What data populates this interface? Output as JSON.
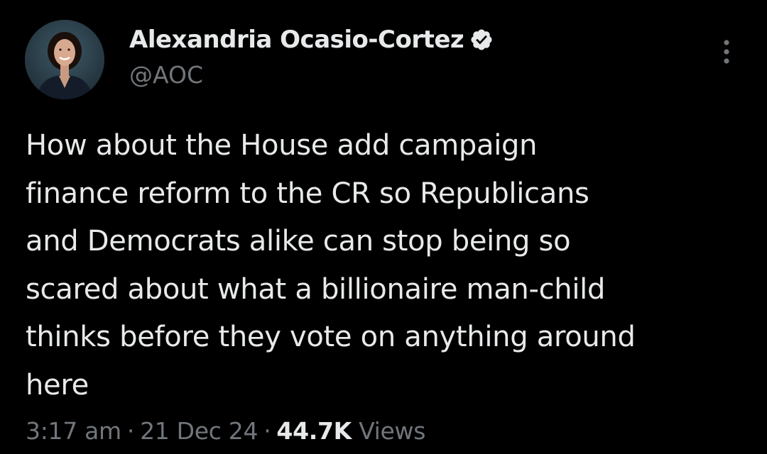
{
  "author": {
    "display_name": "Alexandria Ocasio-Cortez",
    "handle": "@AOC",
    "verified_icon": "verified-badge-icon",
    "verified_color": "#e7e9ea"
  },
  "tweet": {
    "lines": [
      "How about the House add campaign",
      "finance reform to the CR so Republicans",
      "and Democrats alike can stop being so",
      "scared about what a billionaire man-child",
      "thinks before they vote on anything around",
      "here"
    ]
  },
  "meta": {
    "time": "3:17 am",
    "separator": "·",
    "date": "21 Dec 24",
    "views_count": "44.7K",
    "views_label": "Views"
  },
  "colors": {
    "background": "#000000",
    "primary_text": "#e7e9ea",
    "secondary_text": "#71767b"
  },
  "icons": {
    "more": "more-vertical-icon"
  }
}
